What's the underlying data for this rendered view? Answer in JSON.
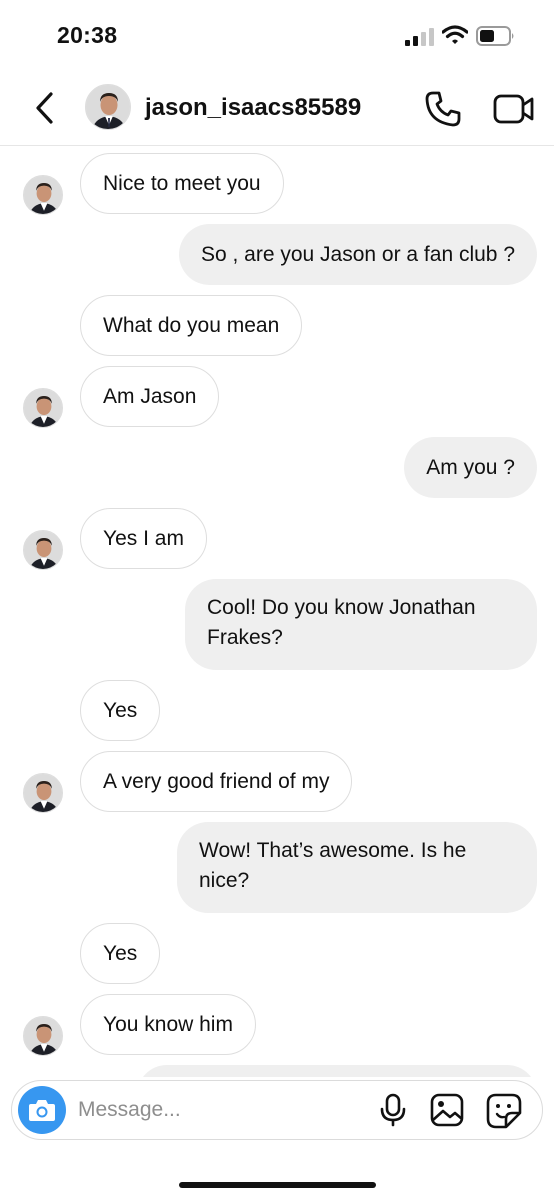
{
  "status_bar": {
    "time": "20:38"
  },
  "header": {
    "username": "jason_isaacs85589"
  },
  "messages": [
    {
      "text": "Nice to meet you"
    },
    {
      "text": "So , are you Jason or a fan club ?"
    },
    {
      "text": "What do you mean"
    },
    {
      "text": "Am Jason"
    },
    {
      "text": "Am you ?"
    },
    {
      "text": "Yes I am"
    },
    {
      "text": "Cool!  Do you know Jonathan Frakes?"
    },
    {
      "text": "Yes"
    },
    {
      "text": "A very good friend of my"
    },
    {
      "text": "Wow!   That’s awesome.  Is he nice?"
    },
    {
      "text": "Yes"
    },
    {
      "text": "You know him"
    }
  ],
  "composer": {
    "placeholder": "Message..."
  },
  "colors": {
    "accent": "#3797f0",
    "outgoing_bubble": "#efefef",
    "incoming_border": "#dedede"
  }
}
